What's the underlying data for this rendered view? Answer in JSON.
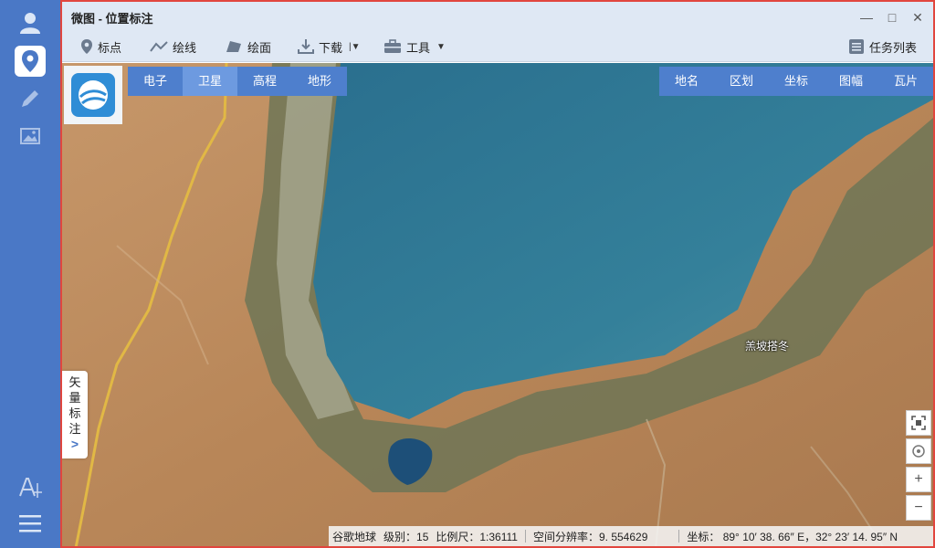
{
  "app": {
    "title": "微图 - 位置标注"
  },
  "window_controls": {
    "minimize": "—",
    "maximize": "□",
    "close": "✕"
  },
  "rail": {
    "items": [
      {
        "name": "user-icon",
        "active": false
      },
      {
        "name": "location-pin-icon",
        "active": true
      },
      {
        "name": "pencil-icon",
        "active": false
      },
      {
        "name": "image-icon",
        "active": false
      }
    ],
    "bottom": [
      {
        "name": "text-cursor-icon"
      },
      {
        "name": "hamburger-menu-icon"
      }
    ]
  },
  "toolbar": {
    "mark_point": "标点",
    "draw_line": "绘线",
    "draw_polygon": "绘面",
    "download": "下载",
    "tools": "工具",
    "task_list": "任务列表"
  },
  "layer_tabs": [
    "电子",
    "卫星",
    "高程",
    "地形"
  ],
  "active_layer": "卫星",
  "overlay_tabs": [
    "地名",
    "区划",
    "坐标",
    "图幅",
    "瓦片"
  ],
  "vector_panel": {
    "chars": [
      "矢",
      "量",
      "标",
      "注"
    ],
    "expand": ">"
  },
  "map_controls": {
    "zoom_in": "+",
    "zoom_out": "−"
  },
  "place_label": "羔坡搭冬",
  "status": {
    "source": "谷歌地球",
    "level": "级别：15",
    "scale": "比例尺：1:36111",
    "resolution": "空间分辨率：9. 554629",
    "coords": "坐标： 89° 10′ 38. 66″ E，32° 23′ 14. 95″ N"
  },
  "colors": {
    "rail": "#4a78c6",
    "tab": "#4e7fcd",
    "tab_active": "#6d9ae0",
    "frame_border": "#e1463e"
  }
}
